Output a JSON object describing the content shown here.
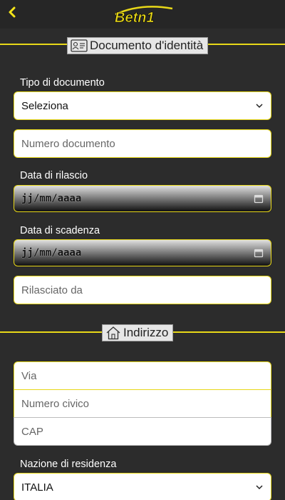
{
  "header": {
    "brand": "Betn1"
  },
  "identity": {
    "section_title": "Documento d'identità",
    "doc_type_label": "Tipo di documento",
    "doc_type_value": "Seleziona",
    "doc_number_placeholder": "Numero documento",
    "issue_date_label": "Data di rilascio",
    "issue_date_value": "jj/mm/aaaa",
    "expiry_date_label": "Data di scadenza",
    "expiry_date_value": "jj/mm/aaaa",
    "issued_by_placeholder": "Rilasciato da"
  },
  "address": {
    "section_title": "Indirizzo",
    "street_placeholder": "Via",
    "house_number_placeholder": "Numero civico",
    "postcode_placeholder": "CAP",
    "country_label": "Nazione di residenza",
    "country_value": "ITALIA"
  },
  "colors": {
    "accent": "#e8d818",
    "background": "#2c2c2c"
  }
}
